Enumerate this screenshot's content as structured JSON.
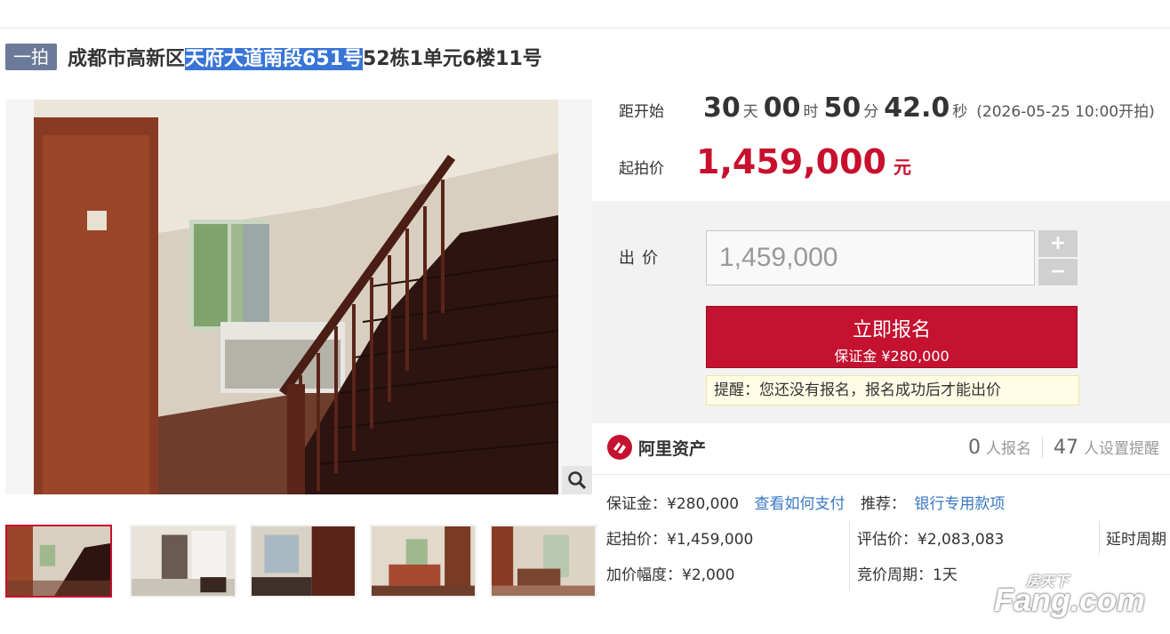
{
  "title": {
    "badge": "一拍",
    "prefix": "成都市高新区",
    "highlighted": "天府大道南段651号",
    "suffix": "52栋1单元6楼11号"
  },
  "countdown": {
    "label": "距开始",
    "days": "30",
    "days_unit": "天",
    "hours": "00",
    "hours_unit": "时",
    "minutes": "50",
    "minutes_unit": "分",
    "seconds": "42.0",
    "seconds_unit": "秒",
    "start_note": "(2026-05-25 10:00开拍)"
  },
  "start_price": {
    "label": "起拍价",
    "value": "1,459,000",
    "unit": "元"
  },
  "bid": {
    "label": "出价",
    "input_value": "1,459,000",
    "plus": "+",
    "minus": "−",
    "signup_label": "立即报名",
    "signup_deposit": "保证金 ¥280,000",
    "reminder": "提醒：您还没有报名，报名成功后才能出价"
  },
  "platform": {
    "name": "阿里资产",
    "signups_count": "0",
    "signups_label": "人报名",
    "reminders_count": "47",
    "reminders_label": "人设置提醒"
  },
  "details": {
    "deposit": "保证金：¥280,000",
    "how_to_pay": "查看如何支付",
    "recommend_label": "推荐：",
    "recommend_link": "银行专用款项",
    "start_price": "起拍价：¥1,459,000",
    "appraisal": "评估价：¥2,083,083",
    "delay": "延时周期",
    "increment": "加价幅度：¥2,000",
    "cycle": "竞价周期：1天"
  },
  "watermark": {
    "top": "房天下",
    "main": "Fang.com"
  },
  "icons": {
    "zoom": "magnifier-icon",
    "logo": "ali-asset-logo-icon"
  },
  "colors": {
    "accent": "#c41230",
    "link": "#3a78c3",
    "badge": "#6b7a99",
    "highlight": "#3875d7"
  }
}
